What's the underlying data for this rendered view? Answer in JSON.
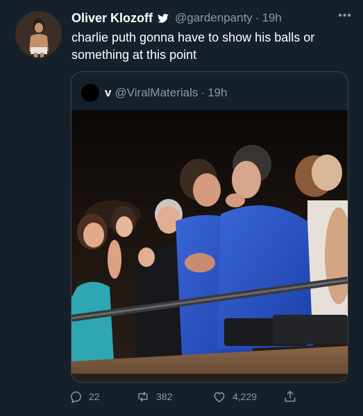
{
  "tweet": {
    "author": {
      "name": "Oliver Klozoff",
      "handle": "@gardenpanty",
      "time": "19h"
    },
    "separator": "·",
    "text": "charlie puth gonna have to show his balls or something at this point",
    "more_label": "•••",
    "quoted": {
      "name": "v",
      "handle": "@ViralMaterials",
      "time": "19h"
    },
    "stats": {
      "replies": "22",
      "retweets": "382",
      "likes": "4,229"
    }
  },
  "colors": {
    "background": "#15202b",
    "secondary_text": "#8b98a5",
    "border": "#38444d",
    "verified": "#1d9bf0"
  },
  "icons": [
    "verified-badge-icon",
    "more-icon",
    "reply-icon",
    "retweet-icon",
    "like-icon",
    "share-icon"
  ]
}
